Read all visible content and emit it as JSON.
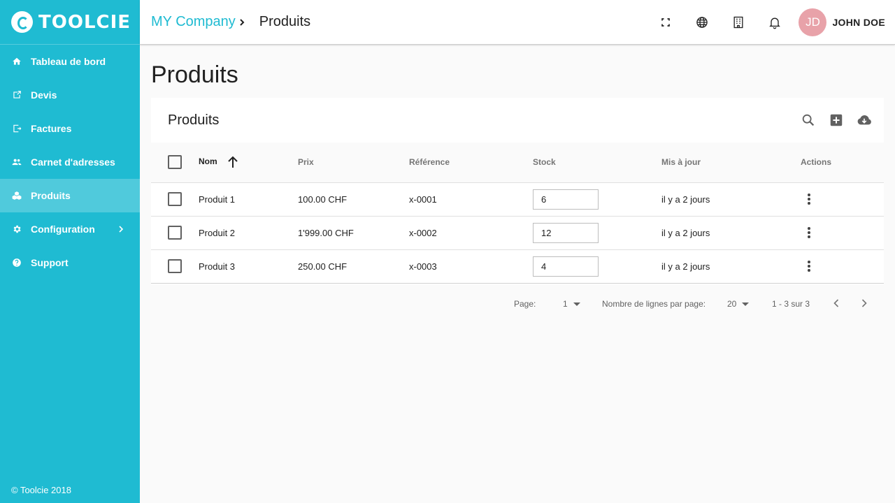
{
  "app": {
    "brand": "TOOLCIE",
    "accent_color": "#1fbbd2",
    "copyright": "© Toolcie 2018"
  },
  "sidebar": {
    "items": [
      {
        "label": "Tableau de bord",
        "icon": "home-icon"
      },
      {
        "label": "Devis",
        "icon": "quote-icon"
      },
      {
        "label": "Factures",
        "icon": "invoice-icon"
      },
      {
        "label": "Carnet d'adresses",
        "icon": "people-icon"
      },
      {
        "label": "Produits",
        "icon": "cubes-icon",
        "active": true
      },
      {
        "label": "Configuration",
        "icon": "gear-icon"
      },
      {
        "label": "Support",
        "icon": "help-icon"
      }
    ]
  },
  "header": {
    "breadcrumb_company": "MY Company",
    "breadcrumb_current": "Produits",
    "avatar_initials": "JD",
    "avatar_color": "#e8a2a9",
    "username": "JOHN DOE"
  },
  "main": {
    "page_title": "Produits",
    "card_title": "Produits",
    "columns": {
      "nom": "Nom",
      "prix": "Prix",
      "ref": "Référence",
      "stock": "Stock",
      "maj": "Mis à jour",
      "actions": "Actions"
    },
    "rows": [
      {
        "nom": "Produit 1",
        "prix": "100.00 CHF",
        "ref": "x-0001",
        "stock": "6",
        "maj": "il y a 2 jours"
      },
      {
        "nom": "Produit 2",
        "prix": "1'999.00 CHF",
        "ref": "x-0002",
        "stock": "12",
        "maj": "il y a 2 jours"
      },
      {
        "nom": "Produit 3",
        "prix": "250.00 CHF",
        "ref": "x-0003",
        "stock": "4",
        "maj": "il y a 2 jours"
      }
    ]
  },
  "pagination": {
    "page_label": "Page:",
    "page_value": "1",
    "rows_label": "Nombre de lignes par page:",
    "rows_value": "20",
    "range": "1 - 3 sur 3"
  }
}
